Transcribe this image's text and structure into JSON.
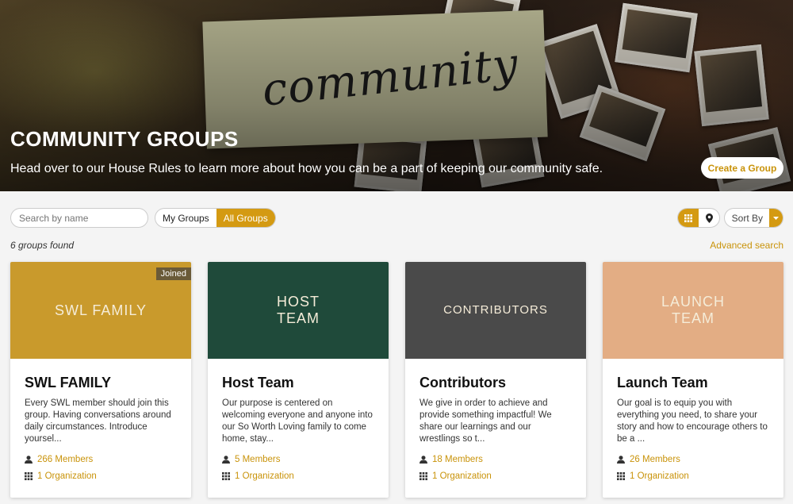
{
  "hero": {
    "script_text": "community",
    "title": "COMMUNITY GROUPS",
    "subtitle": "Head over to our House Rules to learn more about how you can be a part of keeping our community safe.",
    "create_label": "Create a Group"
  },
  "toolbar": {
    "search_placeholder": "Search by name",
    "my_groups": "My Groups",
    "all_groups": "All Groups",
    "sort_label": "Sort By"
  },
  "results": {
    "found": "6 groups found",
    "advanced": "Advanced search"
  },
  "colors": {
    "accent": "#d49a12",
    "link": "#c9930a"
  },
  "cards": [
    {
      "banner_text": "SWL FAMILY",
      "banner_color": "#c99a2c",
      "badge": "Joined",
      "name": "SWL FAMILY",
      "desc": "Every SWL member should join this group. Having conversations around daily circumstances. Introduce yoursel...",
      "members": "266 Members",
      "org": "1 Organization"
    },
    {
      "banner_text": "HOST TEAM",
      "banner_color": "#1f4a3a",
      "name": "Host Team",
      "desc": "Our purpose is centered on welcoming everyone and anyone into our So Worth Loving family to come home, stay...",
      "members": "5 Members",
      "org": "1 Organization"
    },
    {
      "banner_text": "CONTRIBUTORS",
      "banner_color": "#4a4a4a",
      "name": "Contributors",
      "desc": "We give in order to achieve and provide something impactful! We share our learnings and our wrestlings so t...",
      "members": "18 Members",
      "org": "1 Organization"
    },
    {
      "banner_text": "LAUNCH TEAM",
      "banner_color": "#e3ad84",
      "name": "Launch Team",
      "desc": "Our goal is to equip you with everything you need, to share your story and how to encourage others to be a ...",
      "members": "26 Members",
      "org": "1 Organization"
    }
  ]
}
